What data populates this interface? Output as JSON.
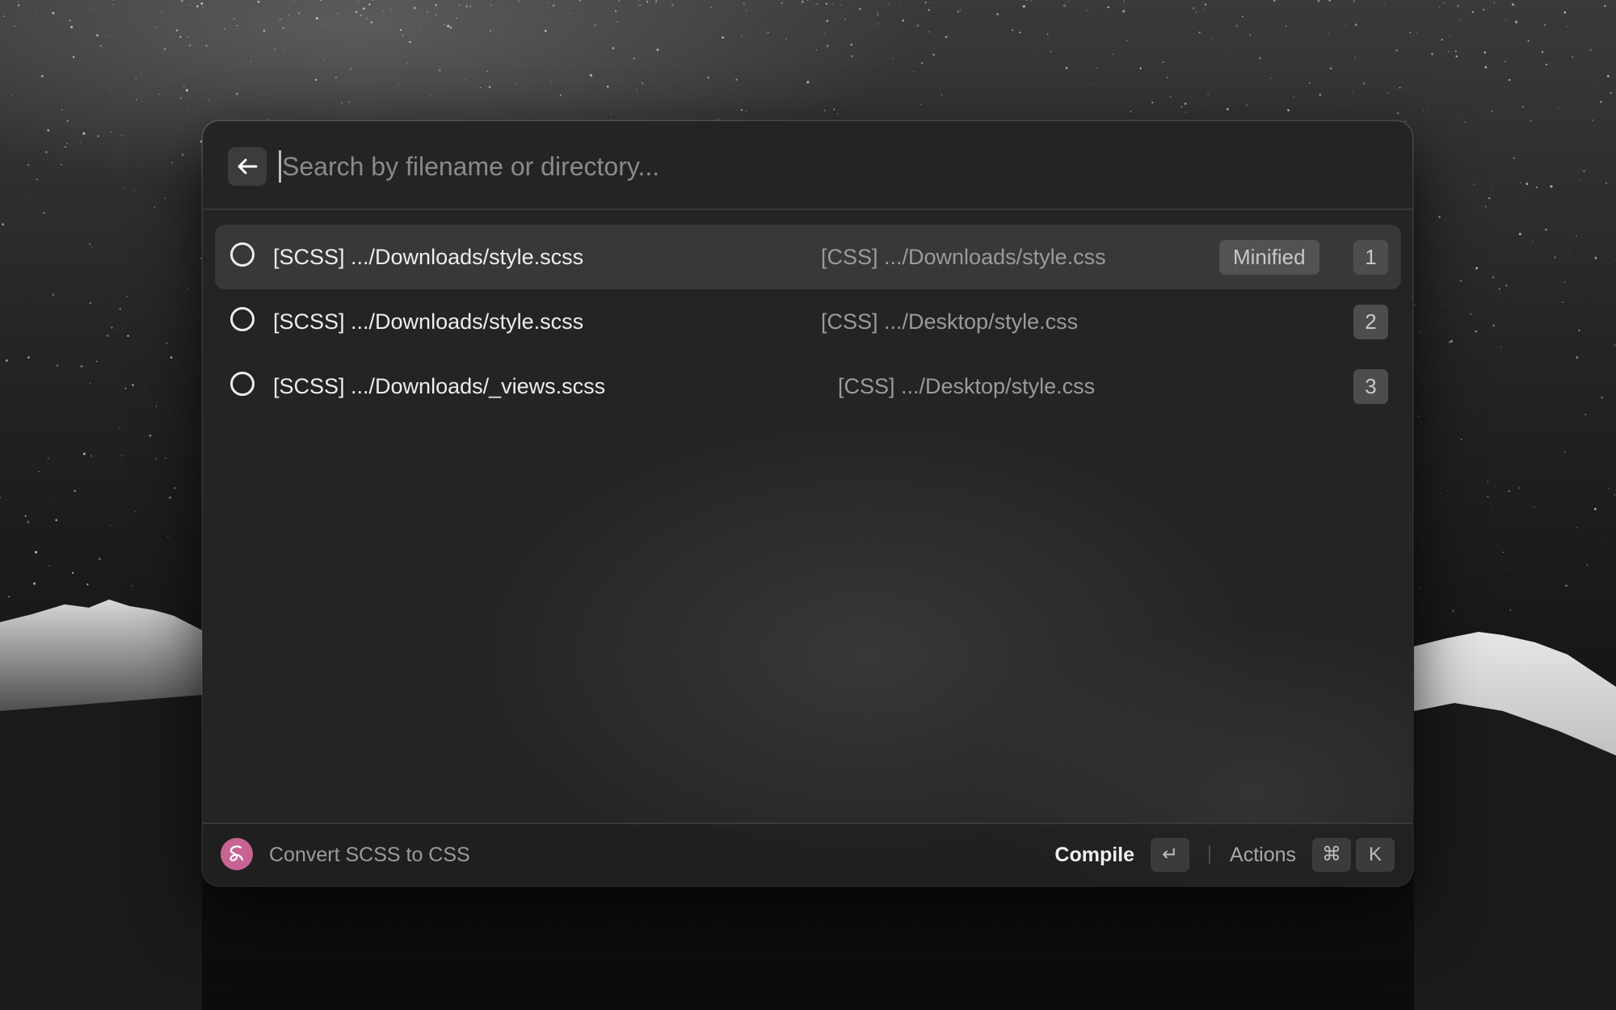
{
  "search": {
    "placeholder": "Search by filename or directory..."
  },
  "results": [
    {
      "title": "[SCSS] .../Downloads/style.scss",
      "subtitle": "[CSS] .../Downloads/style.css",
      "tag": "Minified",
      "shortcut": "1",
      "selected": true
    },
    {
      "title": "[SCSS] .../Downloads/style.scss",
      "subtitle": "[CSS] .../Desktop/style.css",
      "tag": "",
      "shortcut": "2",
      "selected": false
    },
    {
      "title": "[SCSS] .../Downloads/_views.scss",
      "subtitle": "[CSS] .../Desktop/style.css",
      "tag": "",
      "shortcut": "3",
      "selected": false
    }
  ],
  "footer": {
    "extension_icon": "sass-logo-icon",
    "title": "Convert SCSS to CSS",
    "primary_action": "Compile",
    "primary_key": "↵",
    "secondary_action": "Actions",
    "secondary_keys": [
      "⌘",
      "K"
    ]
  },
  "colors": {
    "window_bg": "#242424",
    "selected_row": "#383838",
    "accent_sass": "#c76494"
  }
}
